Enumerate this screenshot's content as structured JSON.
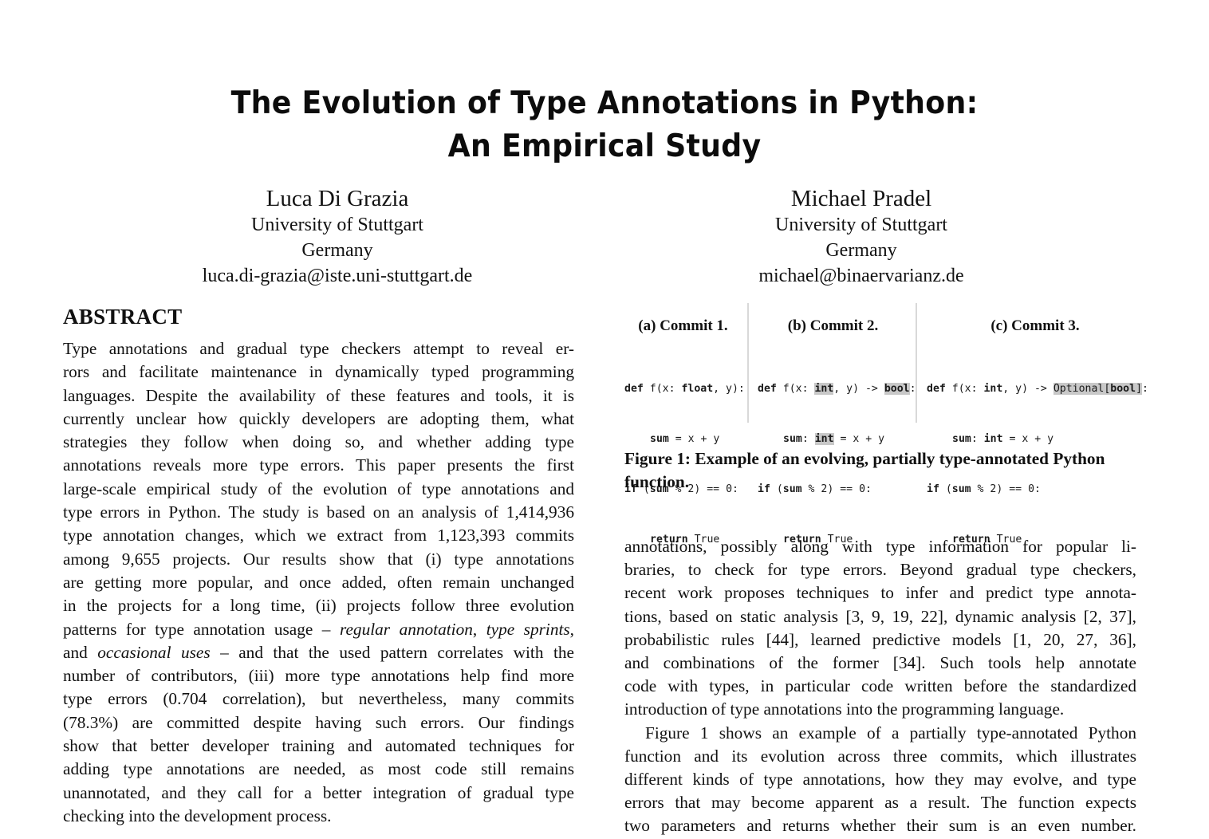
{
  "paper": {
    "title_line1": "The Evolution of Type Annotations in Python:",
    "title_line2": "An Empirical Study",
    "authors": [
      {
        "name": "Luca Di Grazia",
        "affiliation": "University of Stuttgart",
        "country": "Germany",
        "email": "luca.di-grazia@iste.uni-stuttgart.de"
      },
      {
        "name": "Michael Pradel",
        "affiliation": "University of Stuttgart",
        "country": "Germany",
        "email": "michael@binaervarianz.de"
      }
    ]
  },
  "abstract": {
    "heading": "ABSTRACT",
    "lines": [
      "Type annotations and gradual type checkers attempt to reveal er-",
      "rors and facilitate maintenance in dynamically typed programming",
      "languages. Despite the availability of these features and tools, it is",
      "currently unclear how quickly developers are adopting them, what",
      "strategies they follow when doing so, and whether adding type",
      "annotations reveals more type errors. This paper presents the first",
      "large-scale empirical study of the evolution of type annotations and",
      "type errors in Python. The study is based on an analysis of 1,414,936",
      "type annotation changes, which we extract from 1,123,393 commits",
      "among 9,655 projects. Our results show that (i) type annotations",
      "are getting more popular, and once added, often remain unchanged",
      "in the projects for a long time, (ii) projects follow three evolution"
    ],
    "line13_pre": "patterns for type annotation usage – ",
    "line13_em1": "regular annotation",
    "line13_mid": ", ",
    "line13_em2": "type sprints",
    "line13_post": ",",
    "line14_pre": "and ",
    "line14_em": "occasional uses",
    "line14_post": " – and that the used pattern correlates with the",
    "lines_tail": [
      "number of contributors, (iii) more type annotations help find more",
      "type errors (0.704 correlation), but nevertheless, many commits",
      "(78.3%) are committed despite having such errors. Our findings",
      "show that better developer training and automated techniques for",
      "adding type annotations are needed, as most code still remains",
      "unannotated, and they call for a better integration of gradual type",
      "checking into the development process."
    ]
  },
  "figure": {
    "highlight_color": "#c8c8c8",
    "panels": [
      {
        "label": "(a) Commit 1.",
        "code": {
          "l1_def": "def",
          "l1_a": " f(x: ",
          "l1_type": "float",
          "l1_b": ", y):",
          "l2_kw": "sum",
          "l2_rest": " = x + y",
          "l3_kw": "if",
          "l3_a": " (",
          "l3_sum": "sum",
          "l3_b": " % 2) == 0:",
          "l4_kw": "return",
          "l4_rest": " True"
        }
      },
      {
        "label": "(b) Commit 2.",
        "code": {
          "l1_def": "def",
          "l1_a": " f(x: ",
          "l1_type": "int",
          "l1_b": ", y) -> ",
          "l1_ret": "bool",
          "l1_c": ":",
          "l2_kw": "sum",
          "l2_colon": ": ",
          "l2_type": "int",
          "l2_rest": " = x + y",
          "l3_kw": "if",
          "l3_a": " (",
          "l3_sum": "sum",
          "l3_b": " % 2) == 0:",
          "l4_kw": "return",
          "l4_rest": " True"
        }
      },
      {
        "label": "(c) Commit 3.",
        "code": {
          "l1_def": "def",
          "l1_a": " f(x: ",
          "l1_type": "int",
          "l1_b": ", y) -> ",
          "l1_opt": "Optional[",
          "l1_ret": "bool",
          "l1_close": "]",
          "l1_c": ":",
          "l2_kw": "sum",
          "l2_colon": ": ",
          "l2_type": "int",
          "l2_rest": " = x + y",
          "l3_kw": "if",
          "l3_a": " (",
          "l3_sum": "sum",
          "l3_b": " % 2) == 0:",
          "l4_kw": "return",
          "l4_rest": " True"
        }
      }
    ],
    "caption": "Figure 1: Example of an evolving, partially type-annotated Python function."
  },
  "body": {
    "lines": [
      "annotations, possibly along with type information for popular li-",
      "braries, to check for type errors. Beyond gradual type checkers,",
      "recent work proposes techniques to infer and predict type annota-",
      "tions, based on static analysis [3, 9, 19, 22], dynamic analysis [2, 37],",
      "probabilistic rules [44], learned predictive models [1, 20, 27, 36],",
      "and combinations of the former [34]. Such tools help annotate",
      "code with types, in particular code written before the standardized",
      "introduction of type annotations into the programming language.",
      "Figure 1 shows an example of a partially type-annotated Python",
      "function and its evolution across three commits, which illustrates",
      "different kinds of type annotations, how they may evolve, and type",
      "errors that may become apparent as a result. The function expects",
      "two parameters and returns whether their sum is an even number."
    ]
  }
}
